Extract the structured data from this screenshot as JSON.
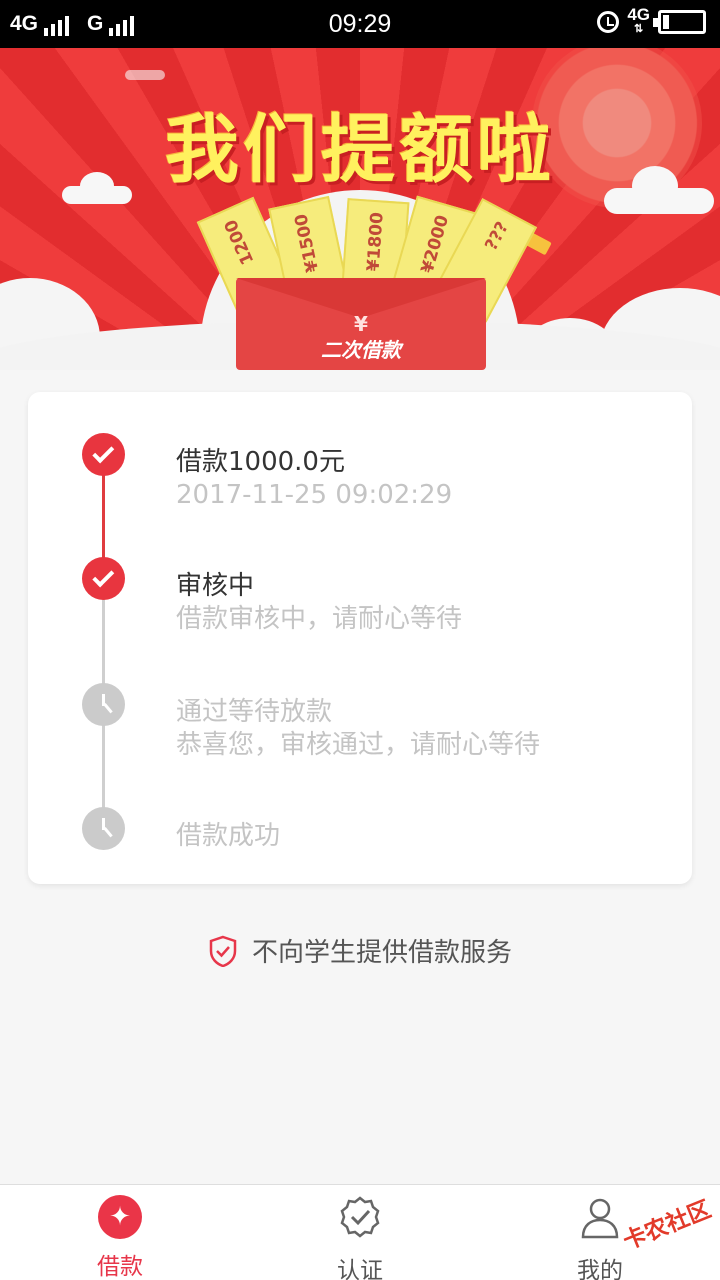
{
  "status_bar": {
    "left": [
      "4G",
      "G"
    ],
    "time": "09:29",
    "network": "4G"
  },
  "banner": {
    "title": "我们提额啦",
    "tickets": [
      "1200",
      "¥1500",
      "¥1800",
      "¥2000",
      "???"
    ],
    "envelope_symbol": "¥",
    "envelope_label": "二次借款"
  },
  "progress": {
    "steps": [
      {
        "title": "借款1000.0元",
        "subtitle": "2017-11-25 09:02:29",
        "status": "done"
      },
      {
        "title": "审核中",
        "subtitle": "借款审核中，请耐心等待",
        "status": "done"
      },
      {
        "title": "通过等待放款",
        "subtitle": "恭喜您，审核通过，请耐心等待",
        "status": "pending"
      },
      {
        "title": "借款成功",
        "subtitle": "",
        "status": "pending"
      }
    ]
  },
  "notice": {
    "text": "不向学生提供借款服务"
  },
  "tabs": [
    {
      "label": "借款",
      "icon": "loan-icon",
      "active": true
    },
    {
      "label": "认证",
      "icon": "badge-check-icon",
      "active": false
    },
    {
      "label": "我的",
      "icon": "user-icon",
      "active": false
    }
  ],
  "watermark": "卡农社区",
  "colors": {
    "accent": "#e7364a",
    "banner_red": "#ef3c3c",
    "muted": "#c4c4c4"
  }
}
